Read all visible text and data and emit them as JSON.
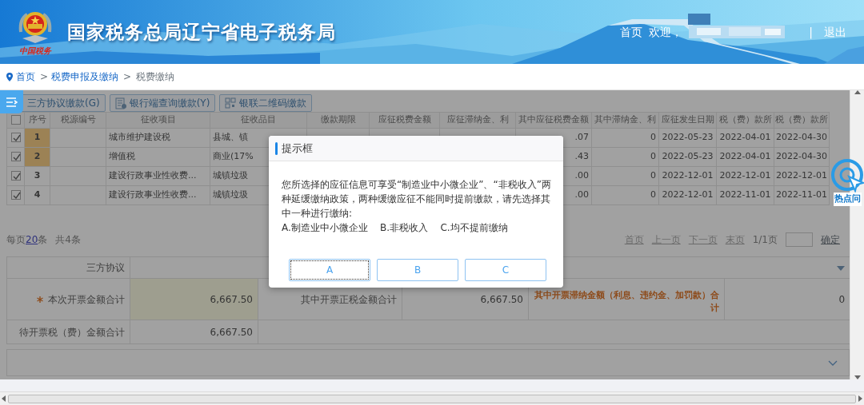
{
  "header": {
    "title": "国家税务总局辽宁省电子税务局",
    "emblem_caption": "中国税务",
    "home": "首页",
    "welcome": "欢迎，",
    "separator": "|",
    "logout": "退出"
  },
  "breadcrumb": [
    {
      "kind": "link",
      "label": "首页"
    },
    {
      "kind": "separator",
      "label": ">"
    },
    {
      "kind": "link",
      "label": "税费申报及缴纳"
    },
    {
      "kind": "separator",
      "label": ">"
    },
    {
      "kind": "current",
      "label": "税费缴纳"
    }
  ],
  "toolbar": [
    {
      "label": "三方协议缴款(G)"
    },
    {
      "label": "银行端查询缴款(Y)"
    },
    {
      "label": "银联二维码缴款"
    }
  ],
  "table": {
    "select_all": {
      "checked": false
    },
    "columns": [
      "序号",
      "税源编号",
      "征收项目",
      "征收品目",
      "缴款期限",
      "应征税费金额",
      "应征滞纳金、利",
      "其中应征税费金额",
      "其中滞纳金、利",
      "应征发生日期",
      "税（费）款所",
      "税（费）款所"
    ],
    "rows": [
      {
        "checked": true,
        "highlighted": true,
        "index": "1",
        "item": "城市维护建设税",
        "subitem": "县城、镇",
        "amount": ".07",
        "late_fee": "0",
        "date": "2022-05-23",
        "period_from": "2022-04-01",
        "period_to": "2022-04-30"
      },
      {
        "checked": true,
        "highlighted": true,
        "index": "2",
        "item": "增值税",
        "subitem": "商业(17%",
        "amount": ".43",
        "late_fee": "0",
        "date": "2022-05-23",
        "period_from": "2022-04-01",
        "period_to": "2022-04-30"
      },
      {
        "checked": true,
        "highlighted": false,
        "index": "3",
        "item": "建设行政事业性收费...",
        "subitem": "城镇垃圾",
        "amount": ".00",
        "late_fee": "0",
        "date": "2022-12-01",
        "period_from": "2022-12-01",
        "period_to": "2022-12-01"
      },
      {
        "checked": true,
        "highlighted": false,
        "index": "4",
        "item": "建设行政事业性收费...",
        "subitem": "城镇垃圾",
        "amount": ".00",
        "late_fee": "0",
        "date": "2022-12-01",
        "period_from": "2022-11-01",
        "period_to": "2022-11-01"
      }
    ]
  },
  "pagination": {
    "per_page_prefix": "每页",
    "per_page": "20",
    "per_page_suffix": "条",
    "total": "共4条",
    "links": [
      {
        "label": "首页",
        "disabled": true
      },
      {
        "label": "上一页",
        "disabled": true
      },
      {
        "label": "下一页",
        "disabled": true
      },
      {
        "label": "末页",
        "disabled": true
      }
    ],
    "page": "1/1页",
    "confirm": "确定"
  },
  "form": {
    "agreement": {
      "label": "三方协议"
    },
    "invoice_total": {
      "label": "本次开票金额合计",
      "required": true,
      "value": "6,667.50"
    },
    "invoice_tax": {
      "label": "其中开票正税金额合计",
      "value": "6,667.50"
    },
    "invoice_late": {
      "label": "其中开票滞纳金额（利息、违约金、加罚款）合计",
      "value": "0"
    },
    "pending_total": {
      "label": "待开票税（费）金额合计",
      "value": "6,667.50"
    }
  },
  "modal": {
    "title": "提示框",
    "message": "您所选择的应征信息可享受“制造业中小微企业”、“非税收入”两种延缓缴纳政策，两种缓缴应征不能同时提前缴款，请先选择其中一种进行缴纳:",
    "options": "A.制造业中小微企业    B.非税收入    C.均不提前缴纳",
    "buttons": [
      {
        "label": "A",
        "focused": true
      },
      {
        "label": "B",
        "focused": false
      },
      {
        "label": "C",
        "focused": false
      }
    ]
  },
  "hot_topics": {
    "label": "热点问"
  }
}
